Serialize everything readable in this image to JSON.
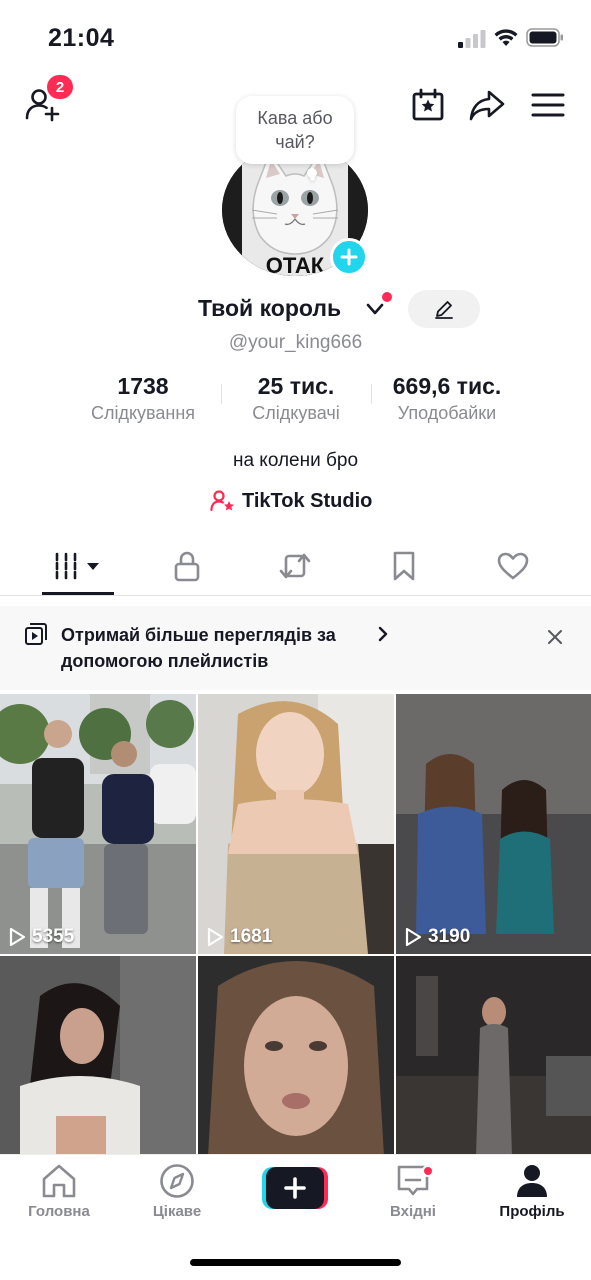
{
  "status_bar": {
    "time": "21:04"
  },
  "header": {
    "friends_badge": "2"
  },
  "profile": {
    "note": "Кава або чай?",
    "avatar_text": "ОТАК",
    "display_name": "Твой король",
    "username": "@your_king666",
    "bio": "на колени бро",
    "studio_link": "TikTok Studio"
  },
  "stats": [
    {
      "value": "1738",
      "label": "Слідкування"
    },
    {
      "value": "25 тис.",
      "label": "Слідкувачі"
    },
    {
      "value": "669,6 тис.",
      "label": "Уподобайки"
    }
  ],
  "tabs": [
    "videos-grid-icon",
    "lock-icon",
    "repost-icon",
    "bookmark-icon",
    "heart-icon"
  ],
  "banner": {
    "text": "Отримай більше переглядів за допомогою плейлистів"
  },
  "videos": [
    {
      "views": "5355"
    },
    {
      "views": "1681"
    },
    {
      "views": "3190"
    },
    {
      "views": ""
    },
    {
      "views": ""
    },
    {
      "views": ""
    }
  ],
  "bottom_nav": {
    "home": "Головна",
    "discover": "Цікаве",
    "inbox": "Вхідні",
    "profile": "Профіль"
  },
  "colors": {
    "accent": "#fe2c55",
    "cyan": "#20d5ec",
    "text": "#161823",
    "secondary": "#8a8b91"
  }
}
